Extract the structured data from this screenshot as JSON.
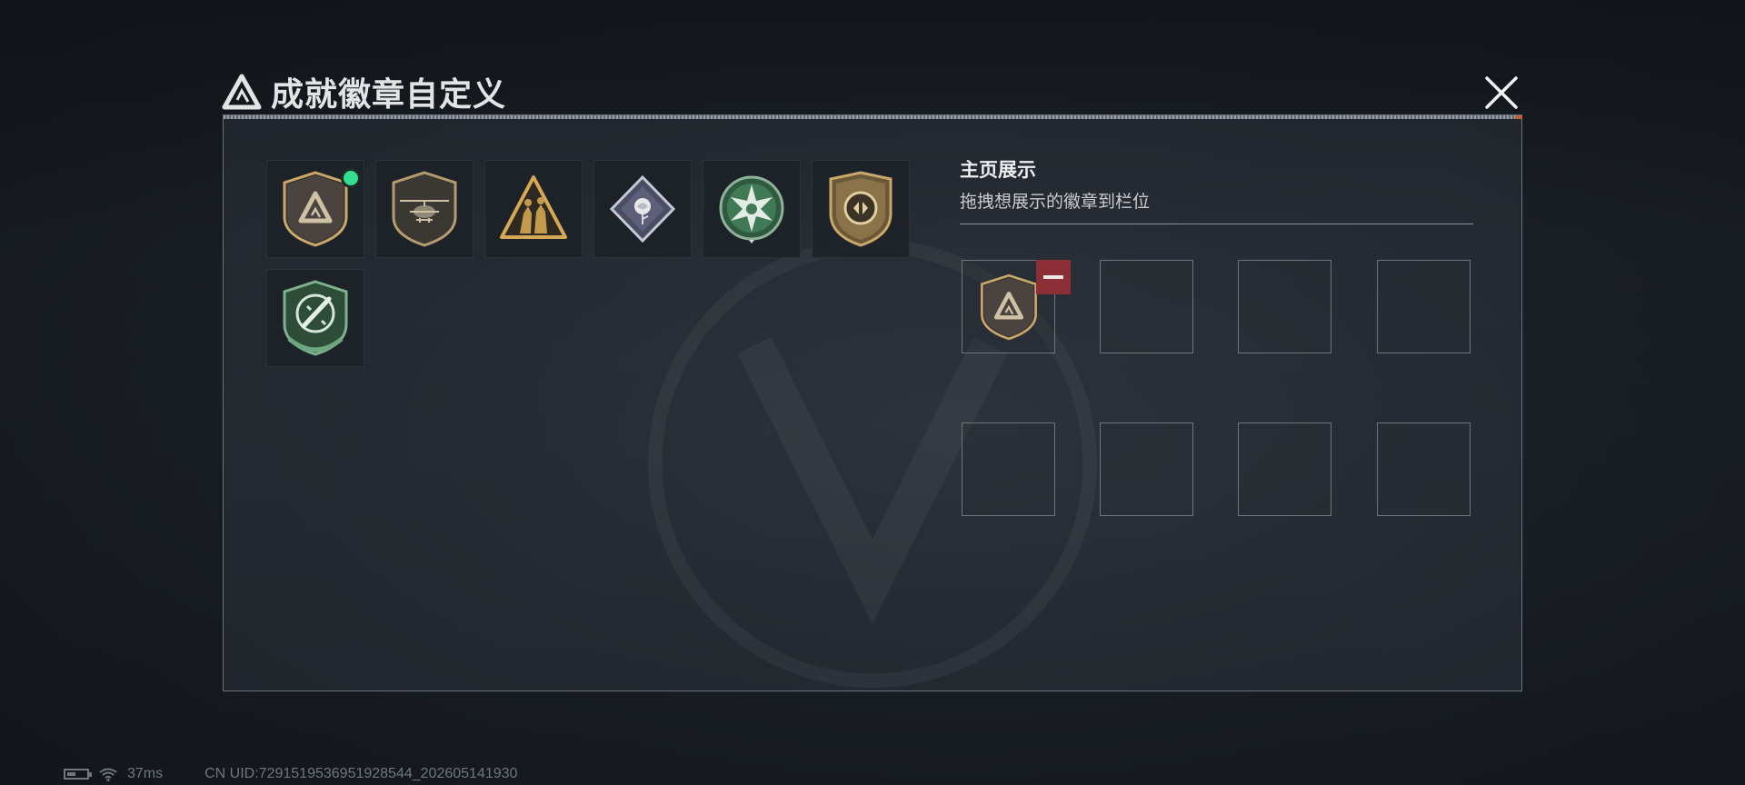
{
  "dialog": {
    "title": "成就徽章自定义"
  },
  "badges": [
    {
      "icon": "triangle-shield-badge-icon",
      "is_new": true
    },
    {
      "icon": "helicopter-shield-badge-icon",
      "is_new": false
    },
    {
      "icon": "soldiers-triangle-badge-icon",
      "is_new": false
    },
    {
      "icon": "rose-diamond-badge-icon",
      "is_new": false
    },
    {
      "icon": "green-star-badge-icon",
      "is_new": false
    },
    {
      "icon": "bronze-shield-badge-icon",
      "is_new": false
    },
    {
      "icon": "green-knife-shield-badge-icon",
      "is_new": false
    }
  ],
  "showcase": {
    "title": "主页展示",
    "subtitle": "拖拽想展示的徽章到栏位",
    "slots": [
      {
        "filled": true,
        "icon": "triangle-shield-badge-icon"
      },
      {
        "filled": false
      },
      {
        "filled": false
      },
      {
        "filled": false
      },
      {
        "filled": false
      },
      {
        "filled": false
      },
      {
        "filled": false
      },
      {
        "filled": false
      }
    ]
  },
  "status": {
    "ping": "37ms",
    "uid": "CN UID:7291519536951928544_202605141930"
  },
  "colors": {
    "accent_new": "#34e08f",
    "remove_red": "#8c2e35",
    "gold": "#c9a86a",
    "green": "#3f7a55"
  }
}
